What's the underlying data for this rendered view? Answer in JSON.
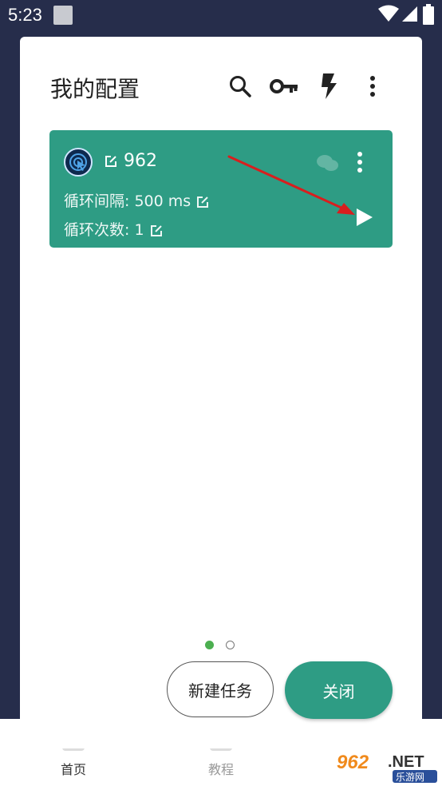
{
  "status_bar": {
    "time": "5:23"
  },
  "dialog": {
    "title": "我的配置",
    "toolbar": {
      "search_icon": "search-icon",
      "key_icon": "key-icon",
      "flash_icon": "flash-icon",
      "more_icon": "more-vert-icon"
    },
    "config": {
      "name": "962",
      "interval_label": "循环间隔: 500 ms",
      "count_label": "循环次数: 1"
    },
    "pagination": {
      "pages": 2,
      "current": 1
    },
    "new_task_label": "新建任务",
    "close_label": "关闭"
  },
  "bottom_nav": {
    "items": [
      "首页",
      "教程"
    ]
  },
  "watermark": {
    "brand": "962",
    "tld": ".NET",
    "sub": "乐游网"
  },
  "colors": {
    "accent": "#2e9c84",
    "backdrop": "#262d4b",
    "annotation": "#d81e1e"
  }
}
